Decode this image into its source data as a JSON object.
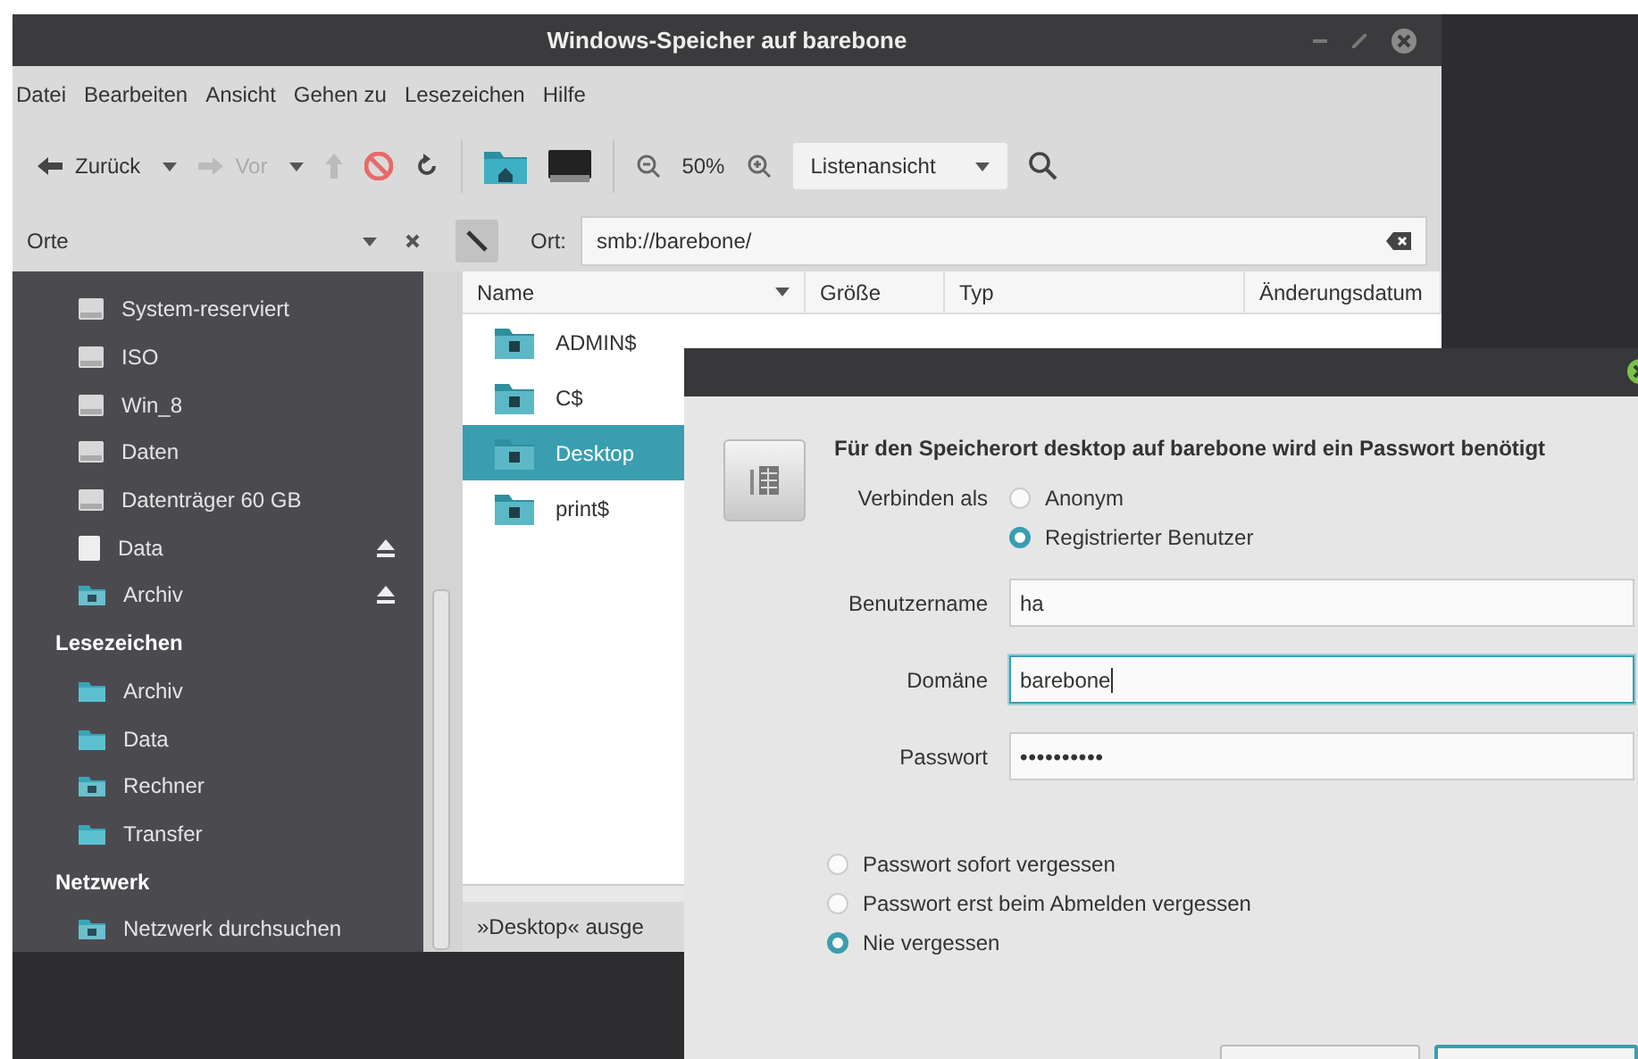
{
  "file_manager": {
    "title": "Windows-Speicher auf barebone",
    "menu": [
      "Datei",
      "Bearbeiten",
      "Ansicht",
      "Gehen zu",
      "Lesezeichen",
      "Hilfe"
    ],
    "toolbar": {
      "back": {
        "label": "Zurück",
        "disabled": false
      },
      "forward": {
        "label": "Vor",
        "disabled": true
      },
      "zoom": "50%",
      "view": "Listenansicht"
    },
    "sidebar_header": "Orte",
    "location": {
      "label": "Ort:",
      "value": "smb://barebone/"
    },
    "sidebar": [
      {
        "kind": "drive",
        "label": "System-reserviert",
        "eject": false
      },
      {
        "kind": "drive",
        "label": "ISO",
        "eject": false
      },
      {
        "kind": "drive",
        "label": "Win_8",
        "eject": false
      },
      {
        "kind": "drive",
        "label": "Daten",
        "eject": false
      },
      {
        "kind": "drive",
        "label": "Datenträger 60 GB",
        "eject": false
      },
      {
        "kind": "removable",
        "label": "Data",
        "eject": true
      },
      {
        "kind": "network",
        "label": "Archiv",
        "eject": true
      },
      {
        "kind": "header",
        "label": "Lesezeichen"
      },
      {
        "kind": "folder",
        "label": "Archiv",
        "eject": false
      },
      {
        "kind": "folder",
        "label": "Data",
        "eject": false
      },
      {
        "kind": "network",
        "label": "Rechner",
        "eject": false
      },
      {
        "kind": "folder",
        "label": "Transfer",
        "eject": false
      },
      {
        "kind": "header",
        "label": "Netzwerk"
      },
      {
        "kind": "network",
        "label": "Netzwerk durchsuchen",
        "eject": false
      }
    ],
    "columns": [
      "Name",
      "Größe",
      "Typ",
      "Änderungsdatum"
    ],
    "files": [
      {
        "name": "ADMIN$",
        "selected": false
      },
      {
        "name": "C$",
        "selected": false
      },
      {
        "name": "Desktop",
        "selected": true
      },
      {
        "name": "print$",
        "selected": false
      }
    ],
    "status": "»Desktop« ausge"
  },
  "dialog": {
    "heading": "Für den Speicherort desktop auf barebone wird ein Passwort benötigt",
    "connect_label": "Verbinden als",
    "connect_options": [
      {
        "label": "Anonym",
        "selected": false
      },
      {
        "label": "Registrierter Benutzer",
        "selected": true
      }
    ],
    "fields": [
      {
        "kind": "text",
        "label": "Benutzername",
        "value": "ha",
        "focused": false
      },
      {
        "kind": "text",
        "label": "Domäne",
        "value": "barebone",
        "focused": true
      },
      {
        "kind": "password",
        "label": "Passwort",
        "value": "••••••••••",
        "focused": false
      }
    ],
    "remember_options": [
      {
        "label": "Passwort sofort vergessen",
        "selected": false
      },
      {
        "label": "Passwort erst beim Abmelden vergessen",
        "selected": false
      },
      {
        "label": "Nie vergessen",
        "selected": true
      }
    ]
  }
}
